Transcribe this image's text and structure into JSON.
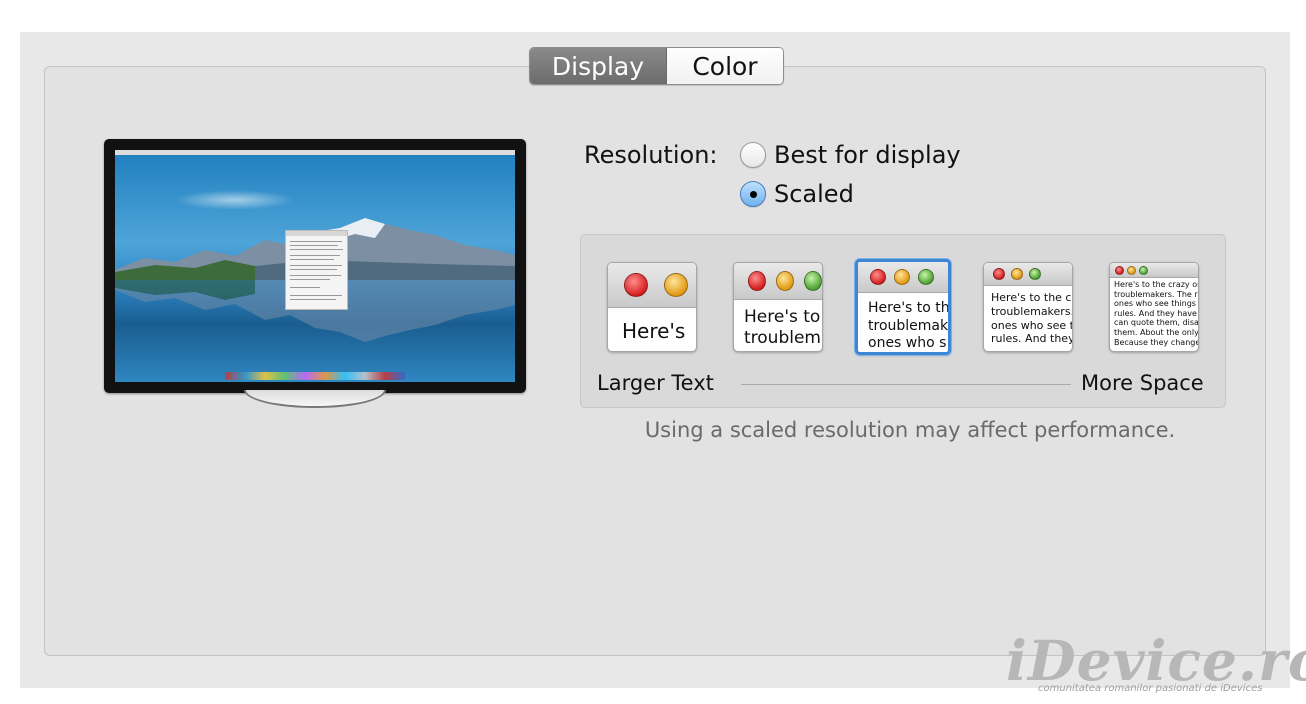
{
  "tabs": [
    {
      "label": "Display",
      "active": true
    },
    {
      "label": "Color",
      "active": false
    }
  ],
  "resolution": {
    "label": "Resolution:",
    "options": [
      {
        "label": "Best for display",
        "selected": false
      },
      {
        "label": "Scaled",
        "selected": true
      }
    ]
  },
  "scaling": {
    "thumbnails": [
      {
        "text": "Here's",
        "selected": false
      },
      {
        "text": "Here's to\ntroublem",
        "selected": false
      },
      {
        "text": "Here's to th\ntroublemak\nones who s",
        "selected": true
      },
      {
        "text": "Here's to the cr\ntroublemakers.\nones who see t\nrules. And they",
        "selected": false
      },
      {
        "text": "Here's to the crazy ones\ntroublemakers. The rou\nones who see things dif\nrules. And they have no\ncan quote them, disagre\nthem. About the only th\nBecause they change th",
        "selected": false
      }
    ],
    "left_label": "Larger Text",
    "right_label": "More Space",
    "note": "Using a scaled resolution may affect performance."
  },
  "watermark": {
    "brand": "iDevice.ro",
    "tagline": "comunitatea romanilor pasionati de iDevices"
  },
  "colors": {
    "selection_blue": "#3d86d4",
    "tab_active": "#7a7a7a"
  }
}
